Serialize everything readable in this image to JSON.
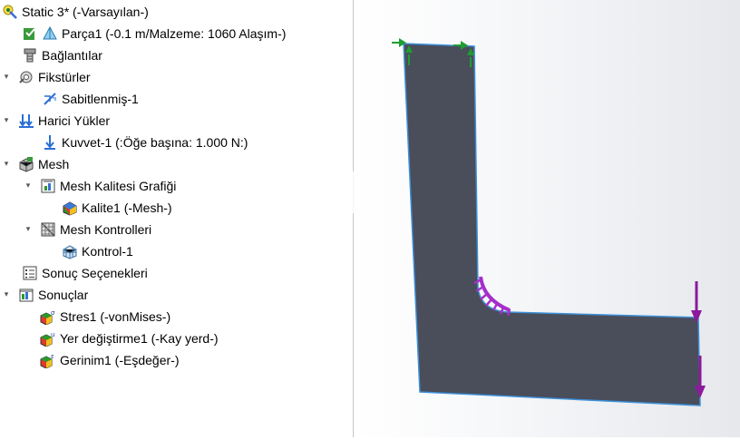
{
  "tree": {
    "study": {
      "label": "Static 3* (-Varsayılan-)",
      "icon": "static-study-icon"
    },
    "part": {
      "label": "Parça1 (-0.1 m/Malzeme: 1060 Alaşım-)",
      "icon": "part-icon"
    },
    "connections": {
      "label": "Bağlantılar",
      "icon": "connections-icon"
    },
    "fixtures": {
      "label": "Fikstürler",
      "icon": "fixtures-icon"
    },
    "fixed": {
      "label": "Sabitlenmiş-1",
      "icon": "fixed-geometry-icon"
    },
    "external_loads": {
      "label": "Harici Yükler",
      "icon": "external-loads-icon"
    },
    "force": {
      "label": "Kuvvet-1 (:Öğe başına: 1.000 N:)",
      "icon": "force-arrow-icon"
    },
    "mesh": {
      "label": "Mesh",
      "icon": "mesh-icon"
    },
    "mesh_quality": {
      "label": "Mesh Kalitesi Grafiği",
      "icon": "mesh-quality-plot-icon"
    },
    "quality1": {
      "label": "Kalite1 (-Mesh-)",
      "icon": "quality-plot-icon"
    },
    "mesh_controls": {
      "label": "Mesh Kontrolleri",
      "icon": "mesh-controls-icon"
    },
    "control1": {
      "label": "Kontrol-1",
      "icon": "mesh-control-icon"
    },
    "result_options": {
      "label": "Sonuç Seçenekleri",
      "icon": "result-options-icon"
    },
    "results": {
      "label": "Sonuçlar",
      "icon": "results-folder-icon"
    },
    "stress1": {
      "label": "Stres1 (-vonMises-)",
      "icon": "stress-plot-icon"
    },
    "displacement1": {
      "label": "Yer değiştirme1 (-Kay yerd-)",
      "icon": "displacement-plot-icon"
    },
    "strain1": {
      "label": "Gerinim1 (-Eşdeğer-)",
      "icon": "strain-plot-icon"
    }
  },
  "viewport": {
    "part_color": "#4a4d5a",
    "fixture_color": "#1e9e2e",
    "load_color": "#8b1a9c",
    "mesh_control_color": "#a52fc9"
  }
}
